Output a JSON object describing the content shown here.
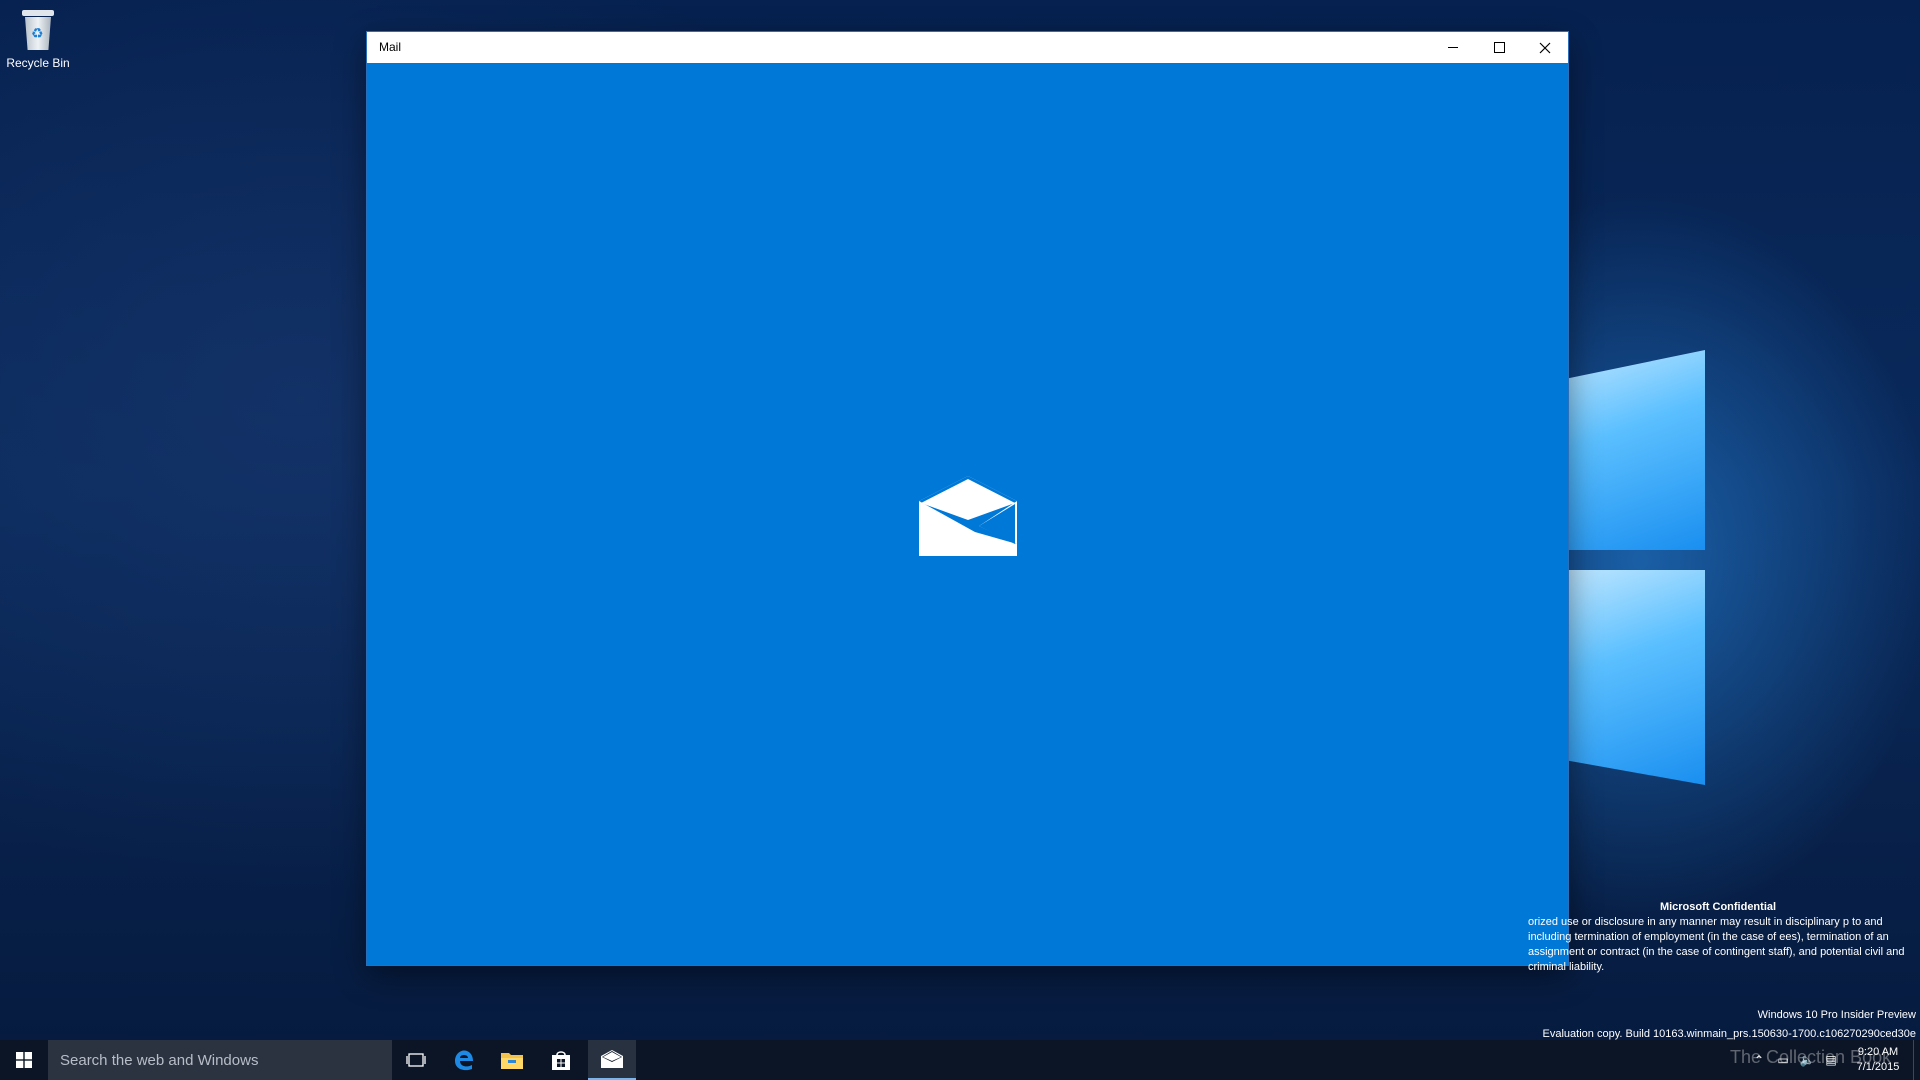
{
  "desktop": {
    "recycle_bin_label": "Recycle Bin"
  },
  "window": {
    "title": "Mail",
    "minimize_label": "Minimize",
    "maximize_label": "Maximize",
    "close_label": "Close",
    "splash_color": "#0078d7"
  },
  "watermark": {
    "heading": "Microsoft Confidential",
    "body": "orized use or disclosure in any manner may result in disciplinary p to and including termination of employment (in the case of ees), termination of an assignment or contract (in the case of contingent staff), and potential civil and criminal liability.",
    "edition": "Windows 10 Pro Insider Preview",
    "build": "Evaluation copy. Build 10163.winmain_prs.150630-1700.c106270290ced30e"
  },
  "taskbar": {
    "search_placeholder": "Search the web and Windows",
    "apps": [
      "task-view",
      "edge",
      "file-explorer",
      "store",
      "mail"
    ],
    "active_app": "mail"
  },
  "tray": {
    "time": "9:20 AM",
    "date": "7/1/2015",
    "brand_text": "The Collection Book"
  }
}
